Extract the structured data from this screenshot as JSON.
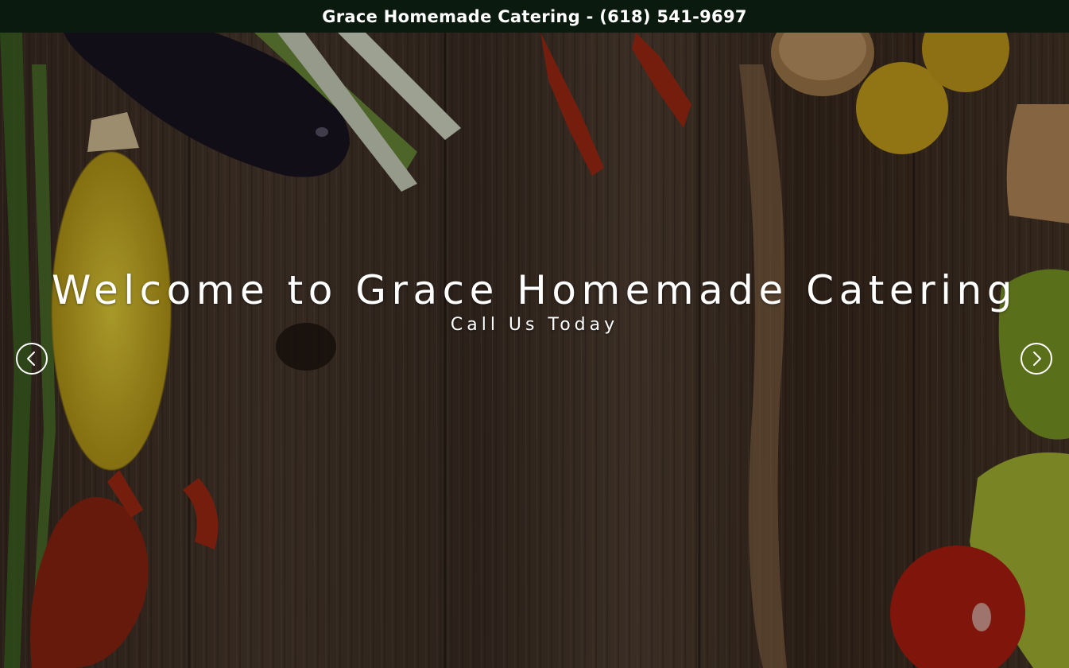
{
  "header": {
    "banner_text": "Grace Homemade Catering - (618) 541-9697"
  },
  "hero": {
    "title": "Welcome to Grace Homemade Catering",
    "subtitle": "Call Us Today",
    "prev_icon": "chevron-left-icon",
    "next_icon": "chevron-right-icon",
    "background": "wooden table with vegetables and crawfish"
  },
  "colors": {
    "topbar_bg": "#0b1a0e",
    "text": "#ffffff"
  }
}
